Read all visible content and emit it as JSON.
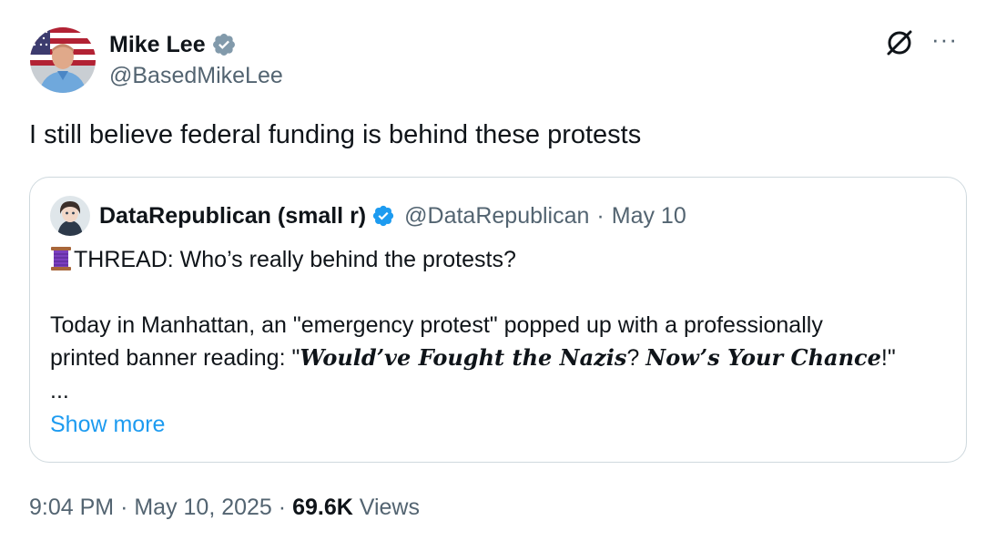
{
  "author": {
    "name": "Mike Lee",
    "handle": "@BasedMikeLee",
    "verified_color": "#829aab"
  },
  "icons": {
    "grok": "grok-icon",
    "more": "more-options-icon",
    "more_glyph": "···"
  },
  "tweet": {
    "text": "I still believe federal funding is behind these protests"
  },
  "quote": {
    "name": "DataRepublican (small r)",
    "handle": "@DataRepublican",
    "separator": "·",
    "date": "May 10",
    "verified_color": "#1d9bf0",
    "line1": "THREAD: Who’s really behind the protests?",
    "line2": "Today in Manhattan, an \"emergency protest\" popped up with a professionally",
    "line3_prefix": "printed banner reading: \"",
    "line3_bold1": "Would’ve Fought the Nazis",
    "line3_mid": "? ",
    "line3_bold2": "Now’s Your Chance",
    "line3_suffix": "!\"",
    "ellipsis": "...",
    "show_more": "Show more"
  },
  "footer": {
    "time": "9:04 PM",
    "sep1": "·",
    "date": "May 10, 2025",
    "sep2": "·",
    "views_count": "69.6K",
    "views_label": "Views"
  },
  "colors": {
    "text_primary": "#0f1419",
    "text_secondary": "#536471",
    "link": "#1d9bf0",
    "border": "#cfd9de"
  }
}
